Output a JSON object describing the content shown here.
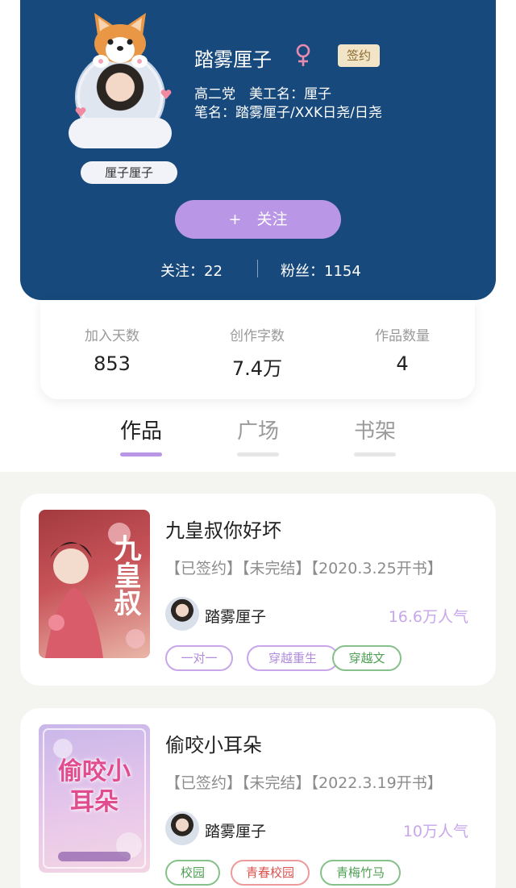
{
  "profile": {
    "name": "踏雾厘子",
    "gender_icon": "female-icon",
    "signed_badge": "签约",
    "nickname": "厘子厘子",
    "line1": "高二党　美工名：厘子",
    "line2": "笔名：踏雾厘子/XXK日尧/日尧",
    "follow_button": "+　关注",
    "following": "关注：22",
    "fans": "粉丝：1154"
  },
  "stats": [
    {
      "label": "加入天数",
      "value": "853"
    },
    {
      "label": "创作字数",
      "value": "7.4万"
    },
    {
      "label": "作品数量",
      "value": "4"
    }
  ],
  "tabs": [
    {
      "label": "作品",
      "active": true
    },
    {
      "label": "广场",
      "active": false
    },
    {
      "label": "书架",
      "active": false
    }
  ],
  "books": [
    {
      "title": "九皇叔你好坏",
      "cover_title": "九皇叔",
      "meta": "【已签约】【未完结】【2020.3.25开书】",
      "author": "踏雾厘子",
      "popularity": "16.6万人气",
      "tags": [
        {
          "label": "一对一",
          "color": "purple"
        },
        {
          "label": "穿越重生",
          "color": "purple"
        },
        {
          "label": "穿越文",
          "color": "green"
        }
      ]
    },
    {
      "title": "偷咬小耳朵",
      "cover_title": "偷咬小耳朵",
      "meta": "【已签约】【未完结】【2022.3.19开书】",
      "author": "踏雾厘子",
      "popularity": "10万人气",
      "tags": [
        {
          "label": "校园",
          "color": "green"
        },
        {
          "label": "青春校园",
          "color": "red"
        },
        {
          "label": "青梅竹马",
          "color": "green"
        }
      ]
    }
  ],
  "colors": {
    "header_bg": "#17497c",
    "accent_purple": "#b996e6",
    "page_bg": "#f4f4f0"
  }
}
